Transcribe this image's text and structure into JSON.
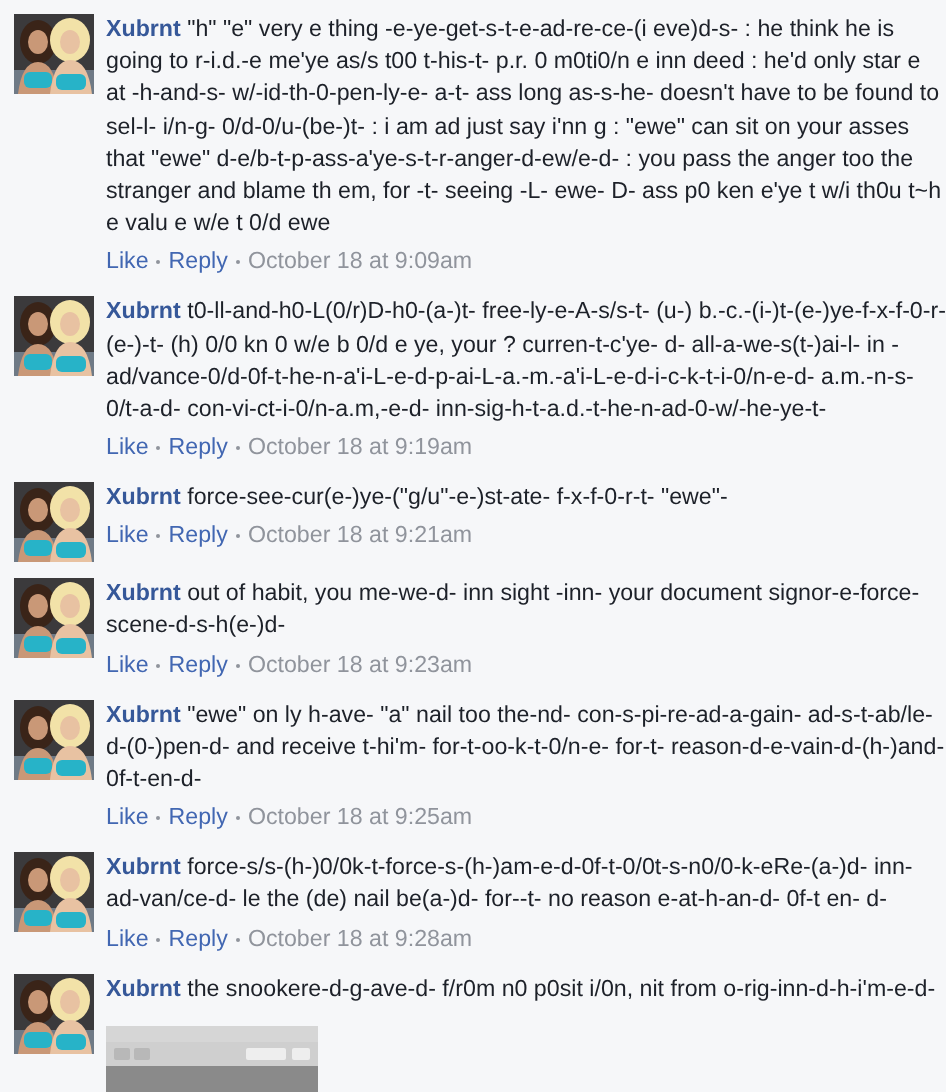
{
  "comments": [
    {
      "author": "Xubrnt",
      "text": "\"h\" \"e\" very e thing -e-ye-get-s-t-e-ad-re-ce-(i eve)d-s- : he think he is going to r-i.d.-e me'ye as/s t00 t-his-t- p.r. 0 m0ti0/n e inn deed : he'd only star e at -h-and-s- w/-id-th-0-pen-ly-e- a-t- ass long as-s-he- doesn't have to be found to sel-l- i/n-g- 0/d-0/u-(be-)t- : i am ad just say i'nn g : \"ewe\" can sit on your asses that \"ewe\" d-e/b-t-p-ass-a'ye-s-t-r-anger-d-ew/e-d- : you pass the anger too the stranger and blame th em, for -t- seeing -L- ewe- D- ass p0 ken e'ye t w/i th0u t~h e valu e w/e t 0/d ewe",
      "like": "Like",
      "reply": "Reply",
      "time": "October 18 at 9:09am"
    },
    {
      "author": "Xubrnt",
      "text": "t0-ll-and-h0-L(0/r)D-h0-(a-)t- free-ly-e-A-s/s-t- (u-) b.-c.-(i-)t-(e-)ye-f-x-f-0-r-(e-)-t- (h) 0/0 kn 0 w/e b 0/d e ye, your ? curren-t-c'ye- d- all-a-we-s(t-)ai-l- in -ad/vance-0/d-0f-t-he-n-a'i-L-e-d-p-ai-L-a.-m.-a'i-L-e-d-i-c-k-t-i-0/n-e-d- a.m.-n-s-0/t-a-d- con-vi-ct-i-0/n-a.m,-e-d- inn-sig-h-t-a.d.-t-he-n-ad-0-w/-he-ye-t-",
      "like": "Like",
      "reply": "Reply",
      "time": "October 18 at 9:19am"
    },
    {
      "author": "Xubrnt",
      "text": "force-see-cur(e-)ye-(\"g/u\"-e-)st-ate- f-x-f-0-r-t- \"ewe\"-",
      "like": "Like",
      "reply": "Reply",
      "time": "October 18 at 9:21am"
    },
    {
      "author": "Xubrnt",
      "text": "out of habit, you me-we-d- inn sight -inn- your document signor-e-force-scene-d-s-h(e-)d-",
      "like": "Like",
      "reply": "Reply",
      "time": "October 18 at 9:23am"
    },
    {
      "author": "Xubrnt",
      "text": "\"ewe\" on ly h-ave- \"a\" nail too the-nd- con-s-pi-re-ad-a-gain- ad-s-t-ab/le-d-(0-)pen-d- and receive t-hi'm- for-t-oo-k-t-0/n-e- for-t- reason-d-e-vain-d-(h-)and-0f-t-en-d-",
      "like": "Like",
      "reply": "Reply",
      "time": "October 18 at 9:25am"
    },
    {
      "author": "Xubrnt",
      "text": "force-s/s-(h-)0/0k-t-force-s-(h-)am-e-d-0f-t-0/0t-s-n0/0-k-eRe-(a-)d- inn-ad-van/ce-d- le the (de) nail be(a-)d- for--t- no reason e-at-h-an-d- 0f-t en- d-",
      "like": "Like",
      "reply": "Reply",
      "time": "October 18 at 9:28am"
    },
    {
      "author": "Xubrnt",
      "text": "the snookere-d-g-ave-d- f/r0m n0 p0sit i/0n, nit from o-rig-inn-d-h-i'm-e-d-",
      "attachment": {
        "kind": "screenshot"
      }
    }
  ]
}
